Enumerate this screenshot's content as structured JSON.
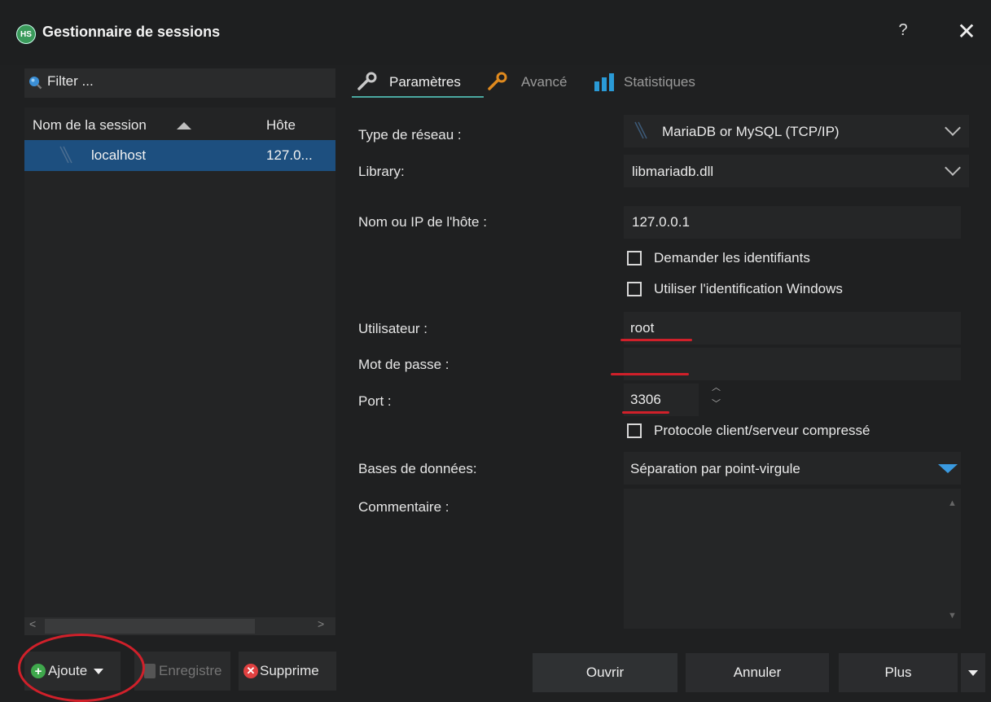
{
  "window": {
    "title": "Gestionnaire de sessions",
    "app_icon": "HS",
    "help": "?",
    "close": "✕"
  },
  "left": {
    "filter_placeholder": "Filter ...",
    "columns": {
      "name": "Nom de la session",
      "host": "Hôte"
    },
    "sessions": [
      {
        "name": "localhost",
        "host": "127.0..."
      }
    ],
    "scroll_left": "<",
    "scroll_right": ">",
    "buttons": {
      "add": "Ajoute",
      "save": "Enregistre",
      "delete": "Supprime"
    }
  },
  "tabs": [
    {
      "label": "Paramètres",
      "icon": "wrench-icon",
      "active": true
    },
    {
      "label": "Avancé",
      "icon": "wrench-orange-icon",
      "active": false
    },
    {
      "label": "Statistiques",
      "icon": "bar-chart-icon",
      "active": false
    }
  ],
  "form": {
    "network_type_label": "Type de réseau :",
    "network_type_value": "MariaDB or MySQL (TCP/IP)",
    "library_label": "Library:",
    "library_value": "libmariadb.dll",
    "host_label": "Nom ou IP de l'hôte :",
    "host_value": "127.0.0.1",
    "ask_credentials": "Demander les identifiants",
    "windows_auth": "Utiliser l'identification Windows",
    "user_label": "Utilisateur :",
    "user_value": "root",
    "password_label": "Mot de passe :",
    "password_value": "",
    "port_label": "Port :",
    "port_value": "3306",
    "compressed": "Protocole client/serveur compressé",
    "databases_label": "Bases de données:",
    "databases_value": "Séparation par point-virgule",
    "comment_label": "Commentaire :",
    "comment_value": ""
  },
  "footer": {
    "open": "Ouvrir",
    "cancel": "Annuler",
    "more": "Plus"
  },
  "colors": {
    "accent_tab": "#4aa8a0",
    "selection": "#1d4f7f",
    "annotation_red": "#d0202a",
    "dropdown_arrow_blue": "#3a9ae0"
  }
}
